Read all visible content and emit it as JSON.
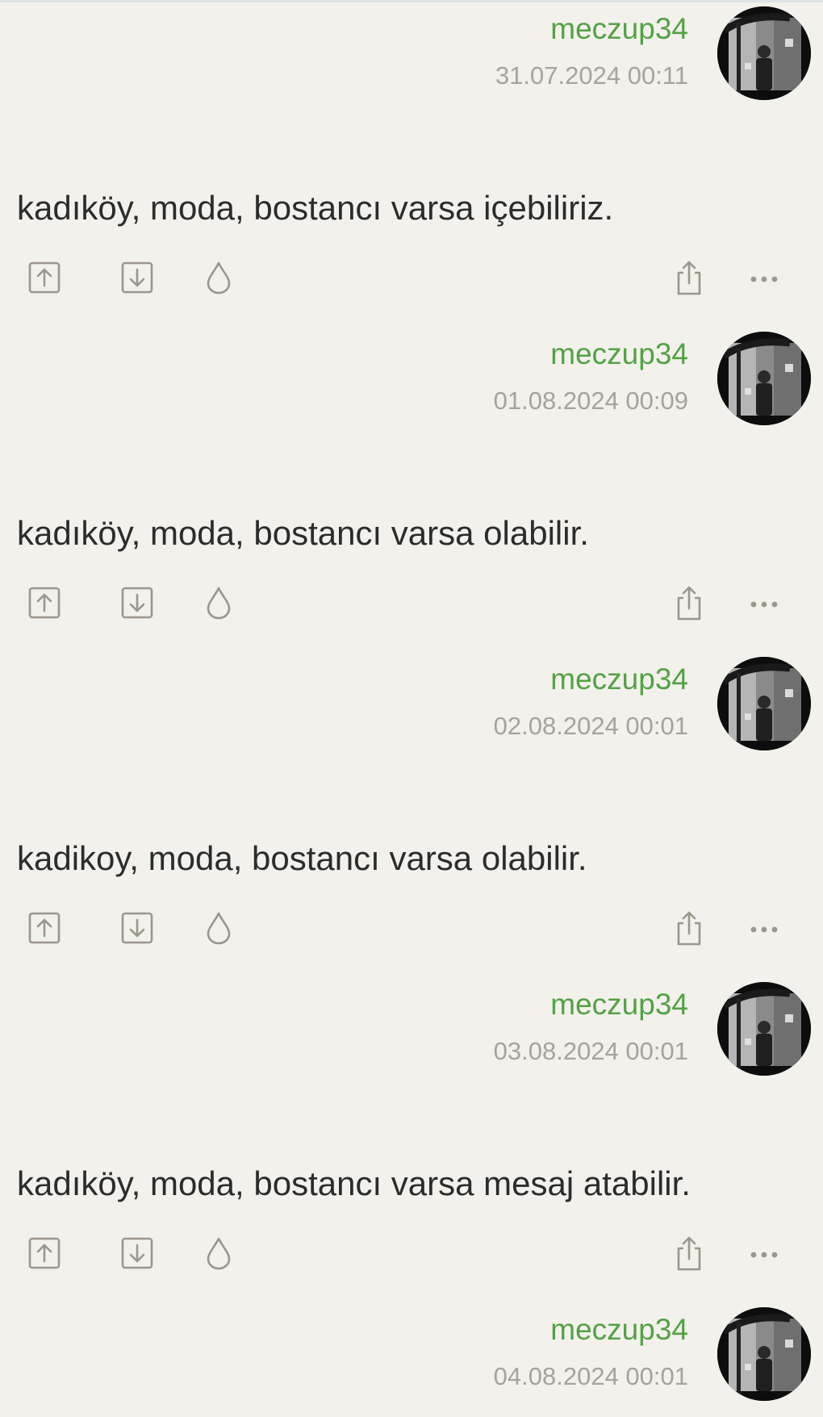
{
  "entries": [
    {
      "author": "meczup34",
      "date": "31.07.2024 00:11",
      "text": "kadıköy, moda, bostancı varsa içebiliriz."
    },
    {
      "author": "meczup34",
      "date": "01.08.2024 00:09",
      "text": "kadıköy, moda, bostancı varsa olabilir."
    },
    {
      "author": "meczup34",
      "date": "02.08.2024 00:01",
      "text": "kadikoy, moda, bostancı varsa olabilir."
    },
    {
      "author": "meczup34",
      "date": "03.08.2024 00:01",
      "text": "kadıköy, moda, bostancı varsa mesaj atabilir."
    },
    {
      "author": "meczup34",
      "date": "04.08.2024 00:01"
    }
  ],
  "icons": {
    "upvote": "upvote-icon",
    "downvote": "downvote-icon",
    "drop": "drop-icon",
    "share": "share-icon",
    "more": "more-icon"
  },
  "colors": {
    "background": "#f3f1ec",
    "author": "#53a245",
    "date": "#a7a39c",
    "text": "#2c2c2c",
    "icon": "#9c968c"
  }
}
